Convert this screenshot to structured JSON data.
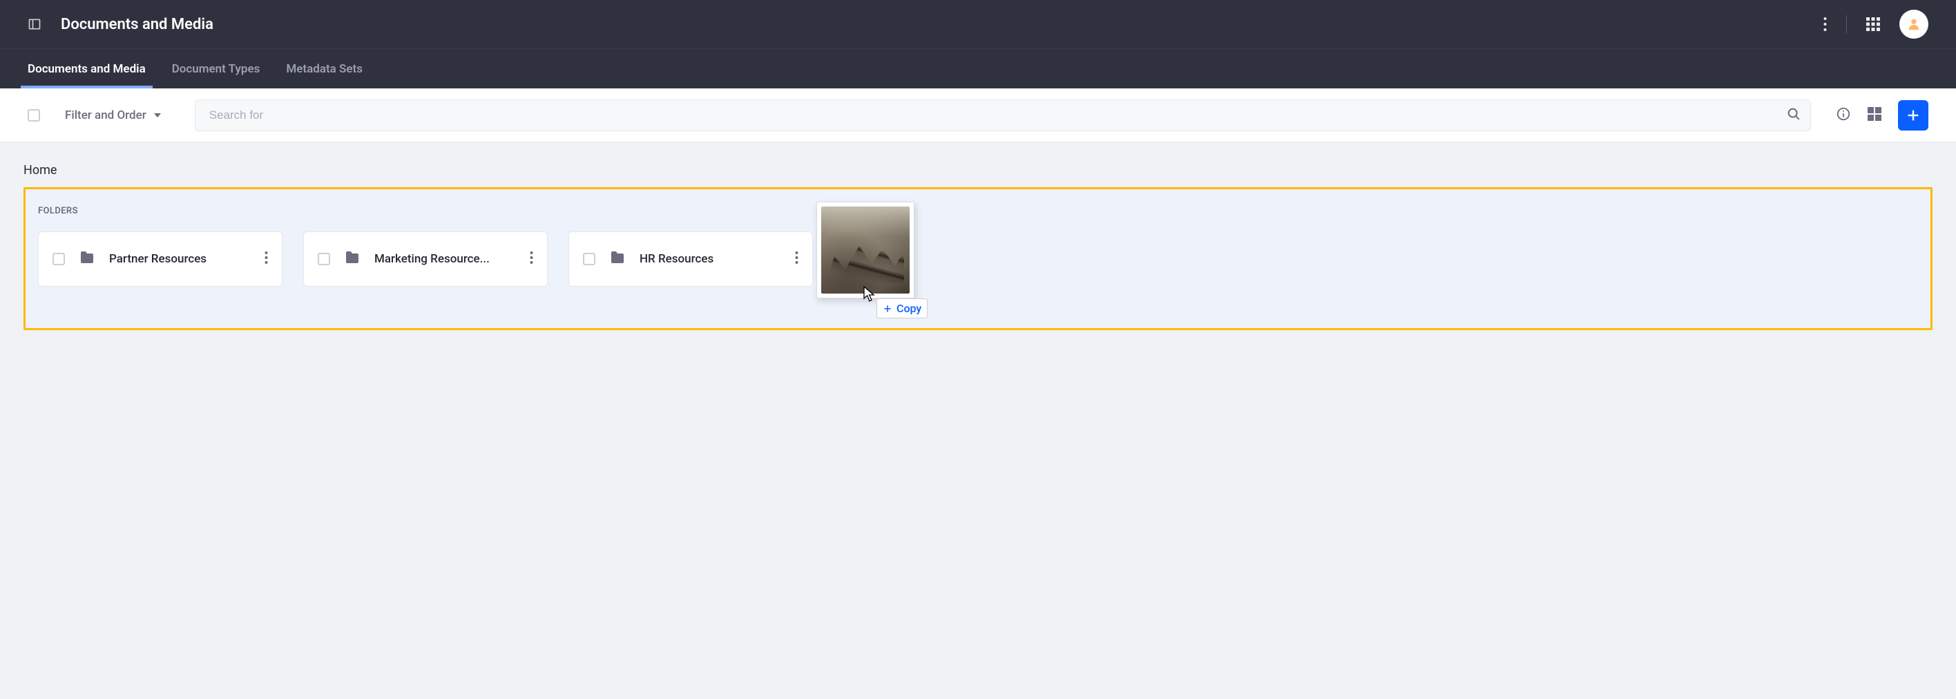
{
  "header": {
    "title": "Documents and Media"
  },
  "tabs": [
    {
      "label": "Documents and Media",
      "active": true
    },
    {
      "label": "Document Types",
      "active": false
    },
    {
      "label": "Metadata Sets",
      "active": false
    }
  ],
  "toolbar": {
    "filter_label": "Filter and Order",
    "search_placeholder": "Search for"
  },
  "breadcrumb": {
    "home": "Home"
  },
  "folders": {
    "section_label": "FOLDERS",
    "items": [
      {
        "name": "Partner Resources"
      },
      {
        "name": "Marketing Resource..."
      },
      {
        "name": "HR Resources"
      }
    ]
  },
  "drag": {
    "copy_label": "Copy"
  }
}
